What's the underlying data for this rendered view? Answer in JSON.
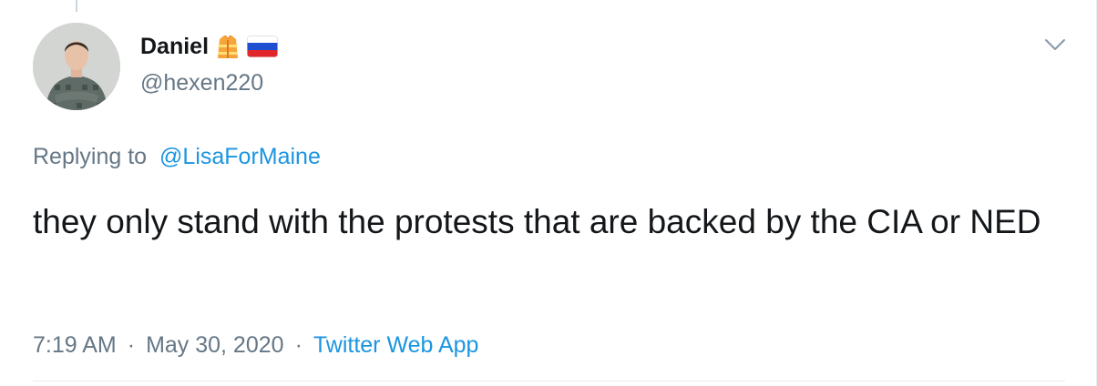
{
  "tweet": {
    "author": {
      "display_name": "Daniel",
      "handle": "@hexen220",
      "badges": [
        "safety-vest-emoji",
        "russia-flag-emoji"
      ]
    },
    "reply_prefix": "Replying to",
    "reply_to": "@LisaForMaine",
    "text": "they only stand with the protests that are backed by the CIA or NED",
    "time": "7:19 AM",
    "separator": "·",
    "date": "May 30, 2020",
    "source": "Twitter Web App",
    "menu_icon": "chevron-down-icon"
  },
  "colors": {
    "text": "#14171a",
    "secondary": "#657786",
    "link": "#1b95e0",
    "border": "#e6ecf0"
  }
}
